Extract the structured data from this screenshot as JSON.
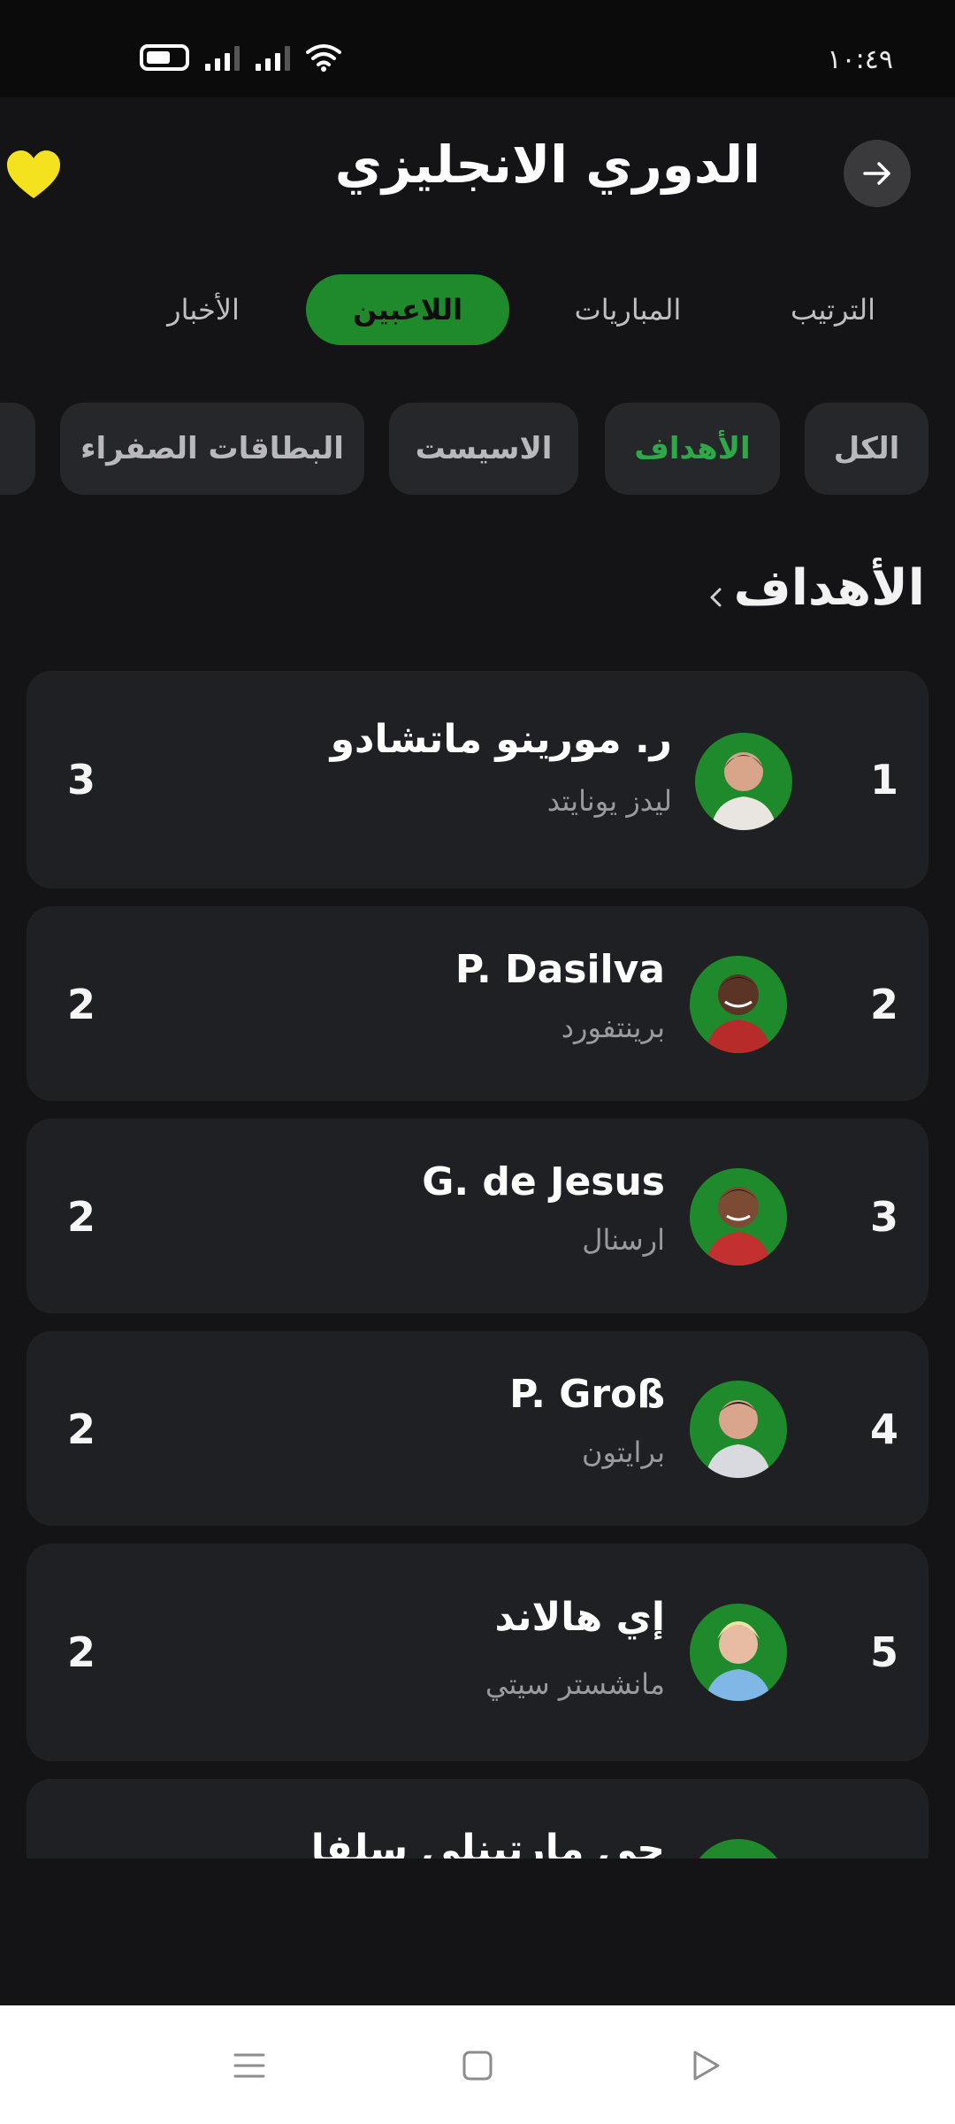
{
  "status_bar": {
    "time": "١٠:٤٩"
  },
  "header": {
    "title": "الدوري الانجليزي"
  },
  "tabs": [
    {
      "label": "الترتيب"
    },
    {
      "label": "المباريات"
    },
    {
      "label": "اللاعبين"
    },
    {
      "label": "الأخبار"
    }
  ],
  "active_tab": "اللاعبين",
  "chips": [
    {
      "label": "الكل"
    },
    {
      "label": "الأهداف"
    },
    {
      "label": "الاسيست"
    },
    {
      "label": "البطاقات الصفراء"
    }
  ],
  "active_chip": "الأهداف",
  "section": {
    "title": "الأهداف"
  },
  "players": [
    {
      "rank": "1",
      "name": "ر. مورينو ماتشادو",
      "team": "ليدز يونايتد",
      "value": "3"
    },
    {
      "rank": "2",
      "name": "P. Dasilva",
      "team": "برينتفورد",
      "value": "2"
    },
    {
      "rank": "3",
      "name": "G. de Jesus",
      "team": "ارسنال",
      "value": "2"
    },
    {
      "rank": "4",
      "name": "P. Groß",
      "team": "برايتون",
      "value": "2"
    },
    {
      "rank": "5",
      "name": "إي هالاند",
      "team": "مانشستر سيتي",
      "value": "2"
    },
    {
      "rank": "",
      "name": "جي مارتينلي سلفا",
      "team": "",
      "value": ""
    }
  ],
  "colors": {
    "background": "#141416",
    "card": "#1f2023",
    "accent_green": "#1f8a2c",
    "active_chip_text": "#2fa84a",
    "heart": "#f5e21f"
  },
  "icons": {
    "favorite": "heart-icon",
    "back": "arrow-right-icon",
    "section_more": "chevron-left-icon",
    "nav_menu": "menu-icon",
    "nav_home": "square-icon",
    "nav_back": "triangle-back-icon"
  }
}
